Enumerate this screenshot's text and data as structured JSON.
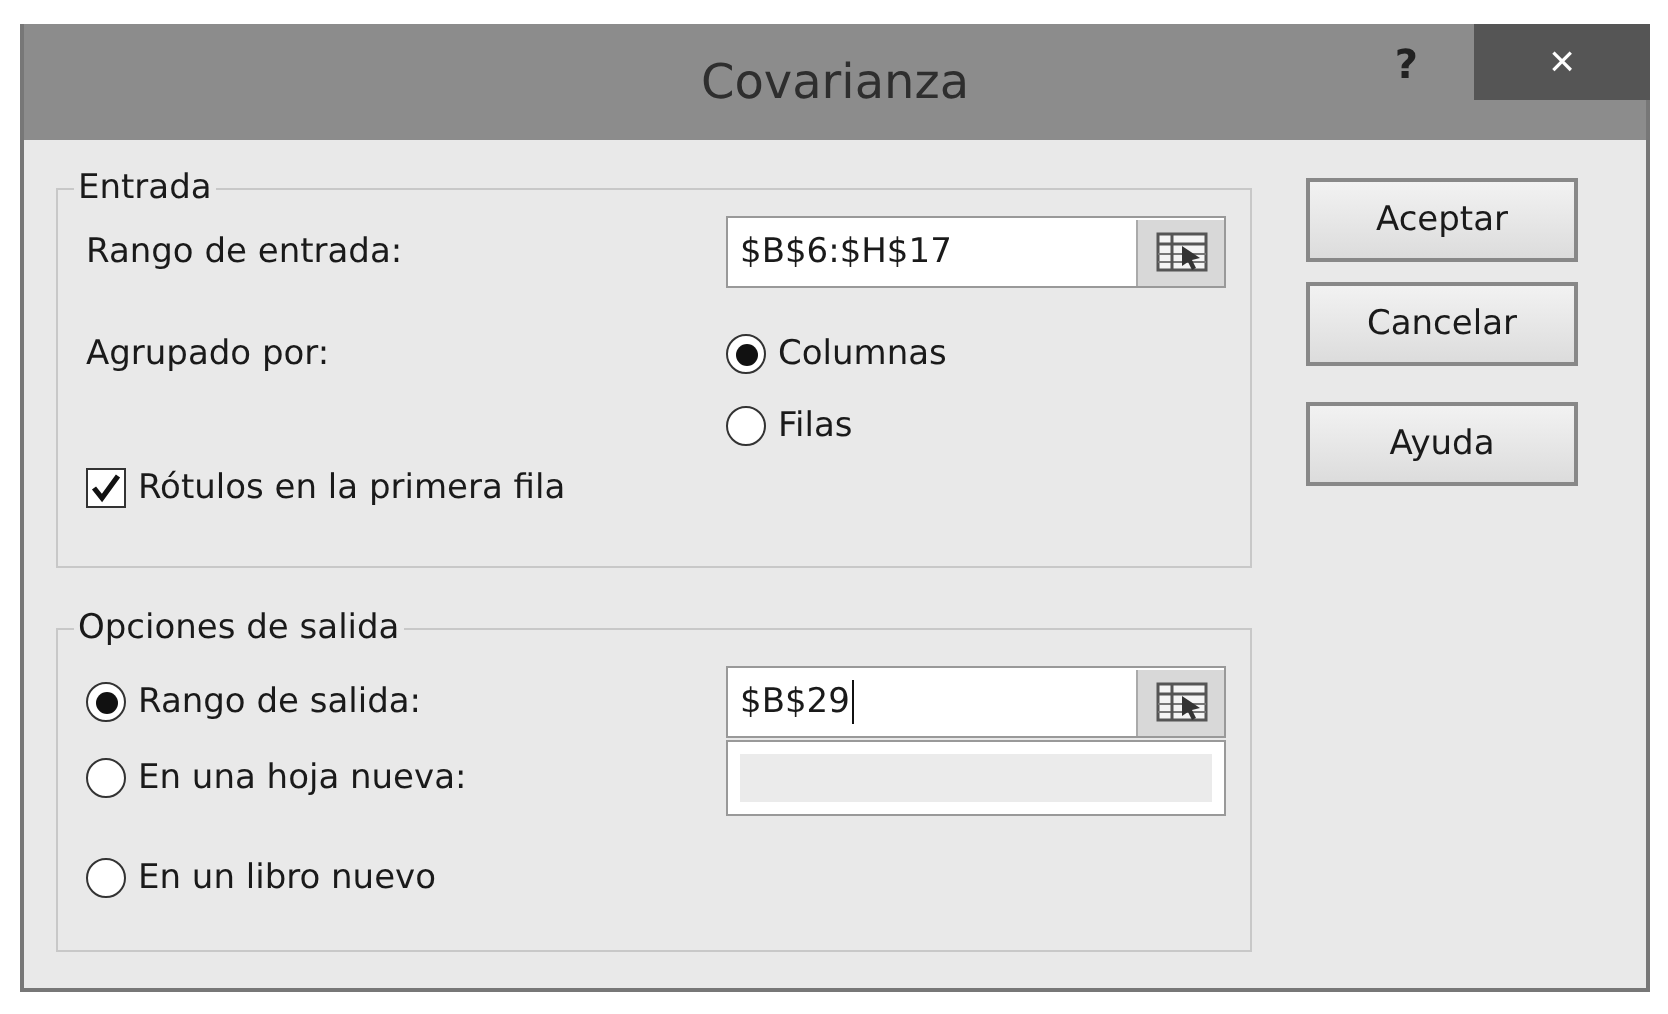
{
  "window": {
    "title": "Covarianza",
    "help": "?",
    "close": "×"
  },
  "input_group": {
    "legend": "Entrada",
    "range_label": "Rango de entrada:",
    "range_value": "$B$6:$H$17",
    "group_label": "Agrupado por:",
    "group_options": [
      {
        "label": "Columnas",
        "selected": true
      },
      {
        "label": "Filas",
        "selected": false
      }
    ],
    "labels_checkbox": {
      "label": "Rótulos en la primera fila",
      "checked": true
    }
  },
  "output_group": {
    "legend": "Opciones de salida",
    "options": [
      {
        "kind": "range",
        "label": "Rango de salida:",
        "selected": true,
        "value": "$B$29",
        "focused": true
      },
      {
        "kind": "sheet",
        "label": "En una hoja nueva:",
        "selected": false,
        "disabled": true
      },
      {
        "kind": "book",
        "label": "En un libro nuevo",
        "selected": false
      }
    ]
  },
  "buttons": [
    "Aceptar",
    "Cancelar",
    "Ayuda"
  ]
}
